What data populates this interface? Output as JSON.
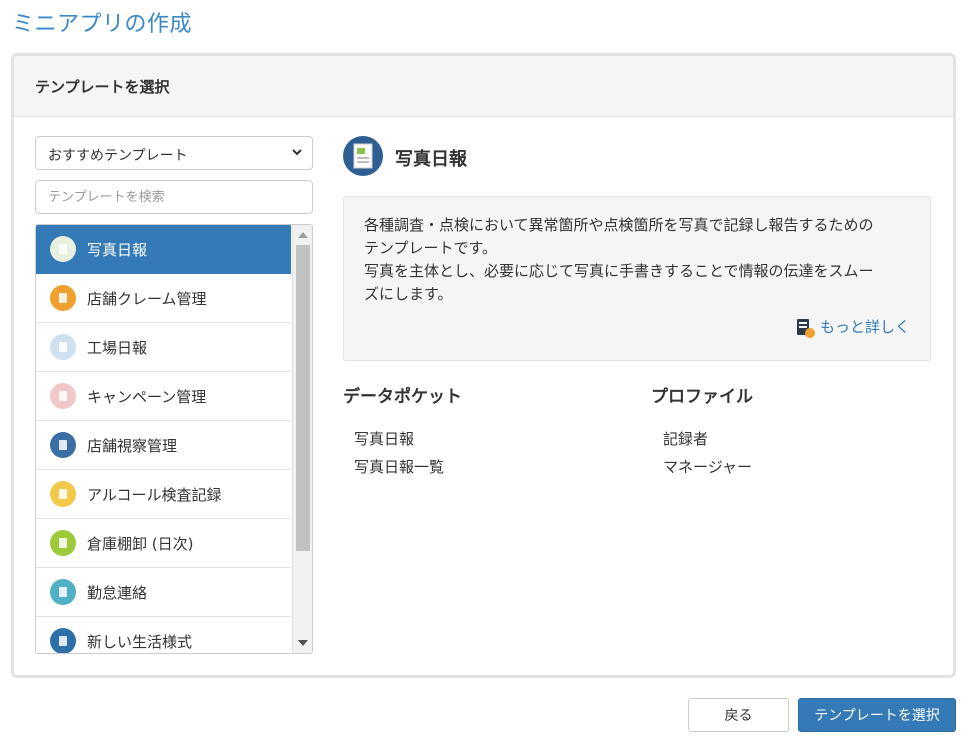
{
  "page": {
    "title": "ミニアプリの作成"
  },
  "panel": {
    "header": "テンプレートを選択"
  },
  "filter": {
    "selected": "おすすめテンプレート",
    "search_placeholder": "テンプレートを検索"
  },
  "templates": [
    {
      "label": "写真日報",
      "icon": "photo-report-icon",
      "color": "#e8f0e0",
      "selected": true
    },
    {
      "label": "店舗クレーム管理",
      "icon": "complaint-icon",
      "color": "#f0a030",
      "selected": false
    },
    {
      "label": "工場日報",
      "icon": "factory-report-icon",
      "color": "#cfe0f0",
      "selected": false
    },
    {
      "label": "キャンペーン管理",
      "icon": "megaphone-icon",
      "color": "#f0c8c8",
      "selected": false
    },
    {
      "label": "店舗視察管理",
      "icon": "store-inspection-icon",
      "color": "#3a6ea5",
      "selected": false
    },
    {
      "label": "アルコール検査記録",
      "icon": "alcohol-check-icon",
      "color": "#f2c94c",
      "selected": false
    },
    {
      "label": "倉庫棚卸 (日次)",
      "icon": "warehouse-inventory-icon",
      "color": "#9ec93a",
      "selected": false
    },
    {
      "label": "勤怠連絡",
      "icon": "attendance-icon",
      "color": "#4fb0c6",
      "selected": false
    },
    {
      "label": "新しい生活様式",
      "icon": "new-lifestyle-icon",
      "color": "#2f6fa8",
      "selected": false
    }
  ],
  "detail": {
    "title": "写真日報",
    "icon": "photo-report-icon",
    "description": [
      "各種調査・点検において異常箇所や点検箇所を写真で記録し報告するための",
      "テンプレートです。",
      "写真を主体とし、必要に応じて写真に手書きすることで情報の伝達をスムー",
      "ズにします。"
    ],
    "more_link": "もっと詳しく"
  },
  "data_pockets": {
    "heading": "データポケット",
    "items": [
      "写真日報",
      "写真日報一覧"
    ]
  },
  "profiles": {
    "heading": "プロファイル",
    "items": [
      "記録者",
      "マネージャー"
    ]
  },
  "footer": {
    "back_label": "戻る",
    "select_label": "テンプレートを選択"
  },
  "colors": {
    "accent": "#337ab7",
    "title": "#3a88c8"
  }
}
